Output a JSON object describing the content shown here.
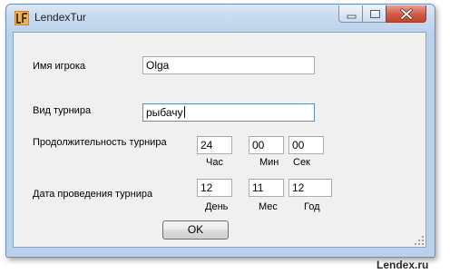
{
  "window": {
    "title": "LendexTur",
    "icon": "app-logo-icon",
    "controls": [
      "minimize-icon",
      "maximize-icon",
      "close-icon"
    ]
  },
  "form": {
    "player_label": "Имя игрока",
    "player_value": "Olga",
    "tournament_type_label": "Вид турнира",
    "tournament_type_value": "рыбачу",
    "duration_label": "Продолжительность турнира",
    "duration": {
      "hours": "24",
      "hours_label": "Час",
      "minutes": "00",
      "minutes_label": "Мин",
      "seconds": "00",
      "seconds_label": "Сек"
    },
    "date_label": "Дата проведения турнира",
    "date": {
      "day": "12",
      "day_label": "День",
      "month": "11",
      "month_label": "Мес",
      "year": "12",
      "year_label": "Год"
    },
    "ok_label": "OK"
  },
  "watermark": "Lendex.ru",
  "colors": {
    "window_frame": "#b9d1ea",
    "client_bg": "#f0f0f0",
    "close_button": "#c4432b"
  }
}
